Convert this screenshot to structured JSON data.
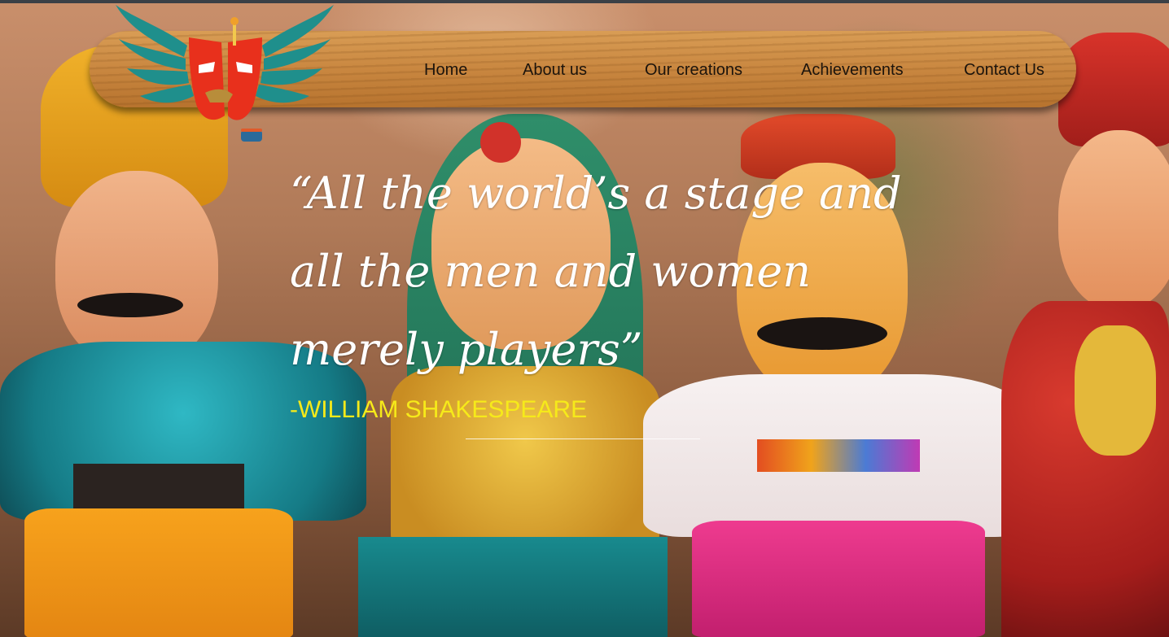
{
  "nav": {
    "items": [
      "Home",
      "About us",
      "Our creations",
      "Achievements",
      "Contact Us"
    ]
  },
  "hero": {
    "quote_lines": [
      "“All the world’s a stage and",
      "all the men and women",
      "merely players”"
    ],
    "author": "-WILLIAM SHAKESPEARE"
  },
  "colors": {
    "nav_wood": "#c98740",
    "nav_text": "#1c140c",
    "quote_text": "#ffffff",
    "author_text": "#f6ea1a",
    "logo_mask_red": "#e8301c",
    "logo_wing_teal": "#1f8f8c"
  },
  "icons": {
    "logo": "winged-mask-logo"
  }
}
